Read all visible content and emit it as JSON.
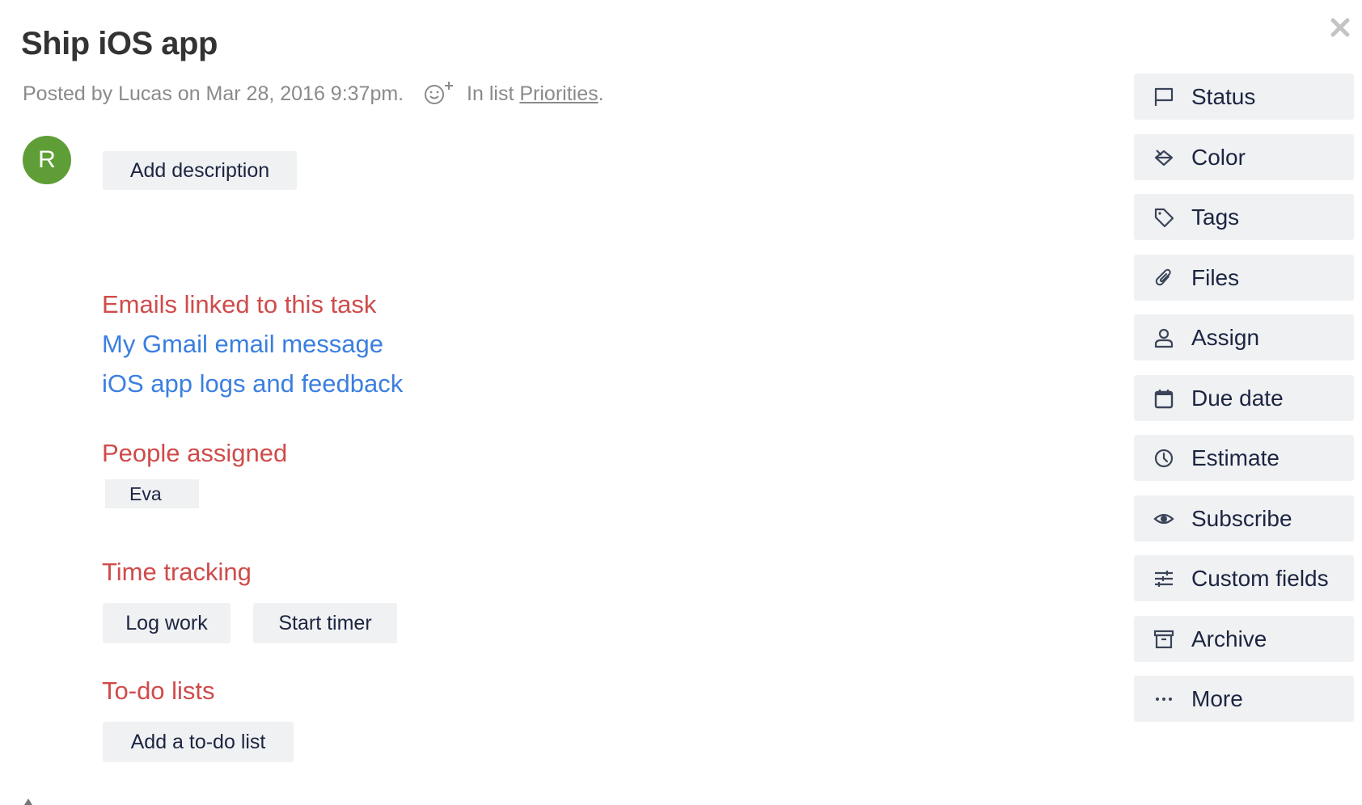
{
  "task": {
    "title": "Ship iOS app",
    "meta_posted": "Posted by Lucas on Mar 28, 2016 9:37pm.",
    "meta_in_list": "In list",
    "list_name": "Priorities",
    "list_period": "."
  },
  "avatar": {
    "initial": "R",
    "color": "#5f9e36"
  },
  "description": {
    "add_label": "Add description"
  },
  "emails": {
    "heading": "Emails linked to this task",
    "items": [
      "My Gmail email message",
      "iOS app logs and feedback"
    ]
  },
  "people": {
    "heading": "People assigned",
    "assignees": [
      "Eva"
    ]
  },
  "time_tracking": {
    "heading": "Time tracking",
    "log_work_label": "Log work",
    "start_timer_label": "Start timer"
  },
  "todo": {
    "heading": "To-do lists",
    "add_label": "Add a to-do list"
  },
  "sidebar": {
    "items": [
      {
        "label": "Status",
        "icon": "flag-icon"
      },
      {
        "label": "Color",
        "icon": "paint-bucket-icon"
      },
      {
        "label": "Tags",
        "icon": "tag-icon"
      },
      {
        "label": "Files",
        "icon": "paperclip-icon"
      },
      {
        "label": "Assign",
        "icon": "user-icon"
      },
      {
        "label": "Due date",
        "icon": "calendar-icon"
      },
      {
        "label": "Estimate",
        "icon": "clock-icon"
      },
      {
        "label": "Subscribe",
        "icon": "eye-icon"
      },
      {
        "label": "Custom fields",
        "icon": "sliders-icon"
      },
      {
        "label": "Archive",
        "icon": "archive-icon"
      },
      {
        "label": "More",
        "icon": "ellipsis-icon"
      }
    ]
  },
  "colors": {
    "heading": "#d04b4b",
    "link": "#3b7fe0",
    "button_bg": "#f0f1f3",
    "button_text": "#1c2541"
  }
}
